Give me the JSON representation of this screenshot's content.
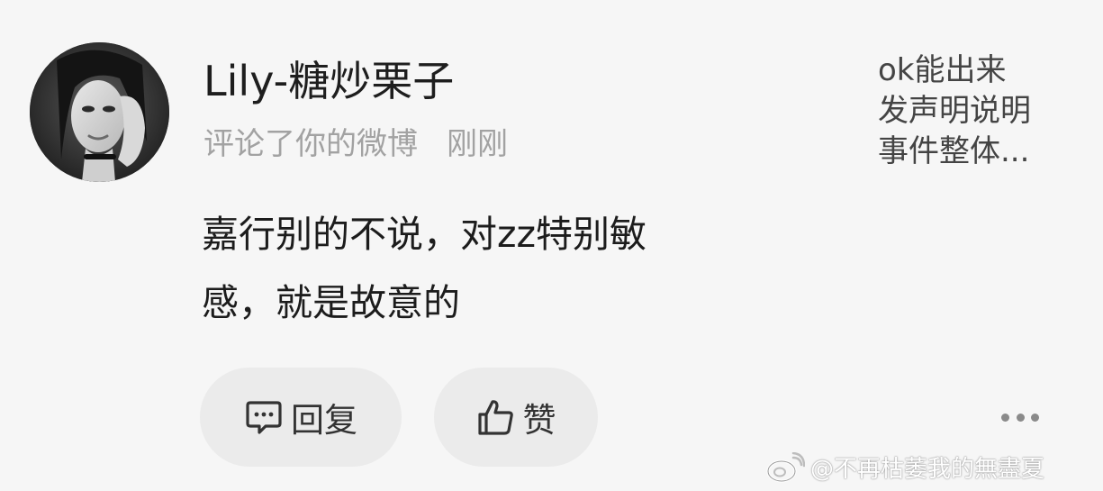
{
  "comment_card": {
    "username": "Lily-糖炒栗子",
    "action": "评论了你的微博",
    "time": "刚刚",
    "comment_lines": [
      "嘉行别的不说，对zz特别敏",
      "感，就是故意的"
    ],
    "original_post_preview": [
      "ok能出来",
      "发声明说明",
      "事件整体..."
    ]
  },
  "actions": {
    "reply_label": "回复",
    "like_label": "赞"
  },
  "icons": {
    "reply": "comment-bubble-icon",
    "like": "thumbs-up-icon",
    "more": "more-dots-icon",
    "watermark": "weibo-logo-icon"
  },
  "watermark": {
    "text": "@不再枯萎我的無盡夏"
  },
  "colors": {
    "background": "#f6f6f6",
    "pill_background": "#ebebeb",
    "meta_text": "#a2a2a2"
  }
}
